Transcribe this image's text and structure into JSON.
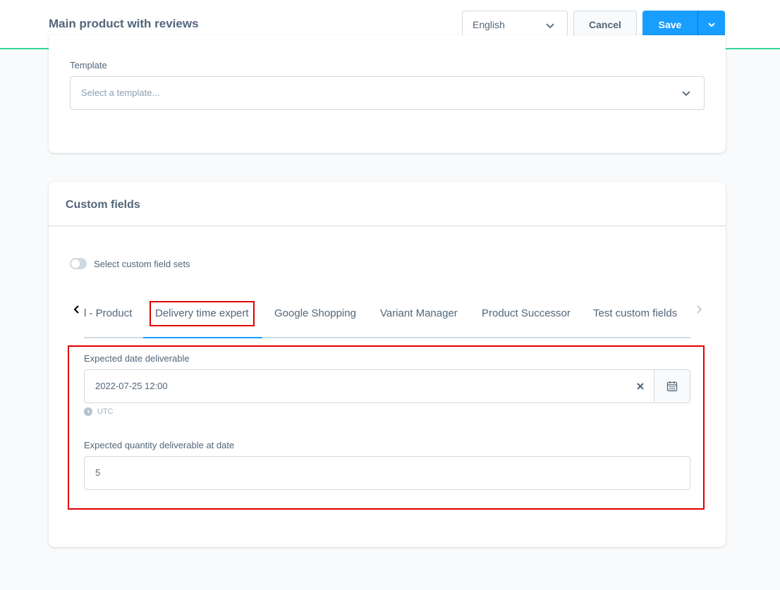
{
  "header": {
    "title": "Main product with reviews",
    "language": "English",
    "cancel_label": "Cancel",
    "save_label": "Save"
  },
  "template_section": {
    "label": "Template",
    "placeholder": "Select a template..."
  },
  "custom_fields": {
    "title": "Custom fields",
    "toggle_label": "Select custom field sets",
    "toggle_on": false,
    "tabs": [
      {
        "label": "l - Product",
        "active": false
      },
      {
        "label": "Delivery time expert",
        "active": true
      },
      {
        "label": "Google Shopping",
        "active": false
      },
      {
        "label": "Variant Manager",
        "active": false
      },
      {
        "label": "Product Successor",
        "active": false
      },
      {
        "label": "Test custom fields",
        "active": false
      }
    ],
    "date_field": {
      "label": "Expected date deliverable",
      "value": "2022-07-25 12:00",
      "timezone": "UTC"
    },
    "quantity_field": {
      "label": "Expected quantity deliverable at date",
      "value": "5"
    }
  },
  "colors": {
    "primary": "#189eff",
    "highlight": "#e00000",
    "topbar_accent": "#37d596"
  }
}
